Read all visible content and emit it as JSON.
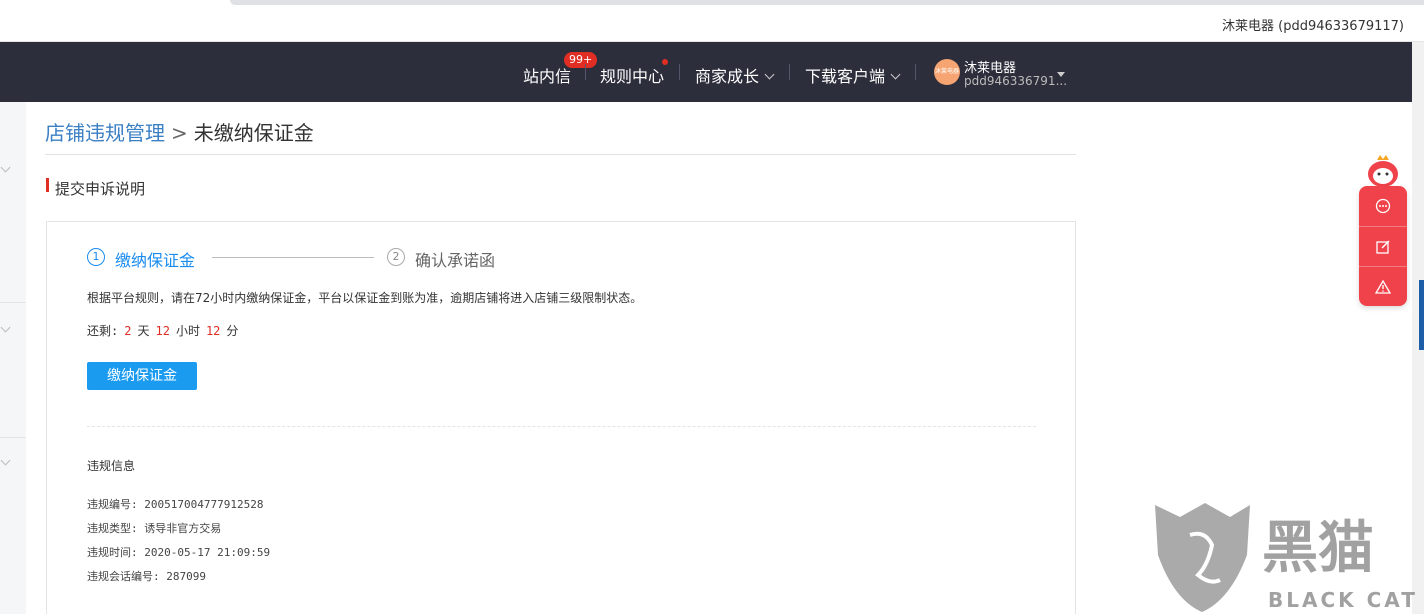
{
  "browser": {
    "account_label": "沐莱电器 (pdd94633679117)"
  },
  "navbar": {
    "messages": {
      "label": "站内信",
      "badge": "99+"
    },
    "rules": {
      "label": "规则中心"
    },
    "growth": {
      "label": "商家成长"
    },
    "download": {
      "label": "下载客户端"
    },
    "user": {
      "avatar_text": "沐莱电器",
      "name": "沐莱电器",
      "id": "pdd946336791..."
    }
  },
  "breadcrumb": {
    "parent": "店铺违规管理",
    "separator": ">",
    "current": "未缴纳保证金"
  },
  "section": {
    "title": "提交申诉说明"
  },
  "steps": [
    {
      "num": "1",
      "label": "缴纳保证金",
      "active": true
    },
    {
      "num": "2",
      "label": "确认承诺函",
      "active": false
    }
  ],
  "rule_text": "根据平台规则，请在72小时内缴纳保证金，平台以保证金到账为准，逾期店铺将进入店铺三级限制状态。",
  "countdown": {
    "prefix": "还剩:",
    "days": "2",
    "days_unit": "天",
    "hours": "12",
    "hours_unit": "小时",
    "minutes": "12",
    "minutes_unit": "分"
  },
  "pay_button": "缴纳保证金",
  "violation": {
    "title": "违规信息",
    "rows": [
      "违规编号: 200517004777912528",
      "违规类型: 诱导非官方交易",
      "违规时间: 2020-05-17 21:09:59",
      "违规会话编号: 287099"
    ]
  },
  "widget": {
    "icons": [
      "chat-icon",
      "edit-icon",
      "warning-icon"
    ]
  },
  "watermark": {
    "cn": "黑猫",
    "en": "BLACK CAT"
  },
  "colors": {
    "navbar": "#2d2e3c",
    "accent": "#1a9bf0",
    "alert": "#e02e24",
    "widget": "#f0424a"
  }
}
